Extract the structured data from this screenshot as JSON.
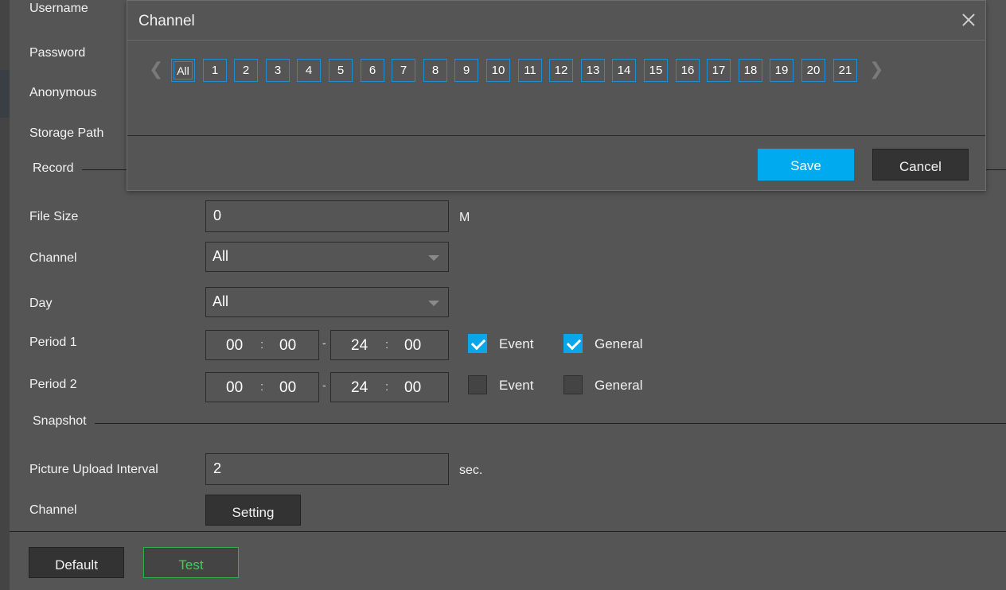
{
  "form": {
    "username_label": "Username",
    "password_label": "Password",
    "anonymous_label": "Anonymous",
    "storage_path_label": "Storage Path",
    "record_section": "Record",
    "file_size_label": "File Size",
    "file_size_value": "0",
    "file_size_unit": "M",
    "channel_label": "Channel",
    "channel_value": "All",
    "day_label": "Day",
    "day_value": "All",
    "period1": {
      "label": "Period 1",
      "start_h": "00",
      "start_m": "00",
      "end_h": "24",
      "end_m": "00",
      "event_label": "Event",
      "event_checked": true,
      "general_label": "General",
      "general_checked": true
    },
    "period2": {
      "label": "Period 2",
      "start_h": "00",
      "start_m": "00",
      "end_h": "24",
      "end_m": "00",
      "event_label": "Event",
      "event_checked": false,
      "general_label": "General",
      "general_checked": false
    },
    "time_separator": ":",
    "range_separator": "-",
    "snapshot_section": "Snapshot",
    "upload_interval_label": "Picture Upload Interval",
    "upload_interval_value": "2",
    "upload_interval_unit": "sec.",
    "snapshot_channel_label": "Channel",
    "setting_button": "Setting"
  },
  "footer": {
    "default_button": "Default",
    "test_button": "Test",
    "test_color": "#3ecf5a"
  },
  "modal": {
    "title": "Channel",
    "prev_arrow": "❮",
    "next_arrow": "❯",
    "channels": [
      "All",
      "1",
      "2",
      "3",
      "4",
      "5",
      "6",
      "7",
      "8",
      "9",
      "10",
      "11",
      "12",
      "13",
      "14",
      "15",
      "16",
      "17",
      "18",
      "19",
      "20",
      "21"
    ],
    "save_button": "Save",
    "cancel_button": "Cancel",
    "accent_color": "#00aaee"
  }
}
